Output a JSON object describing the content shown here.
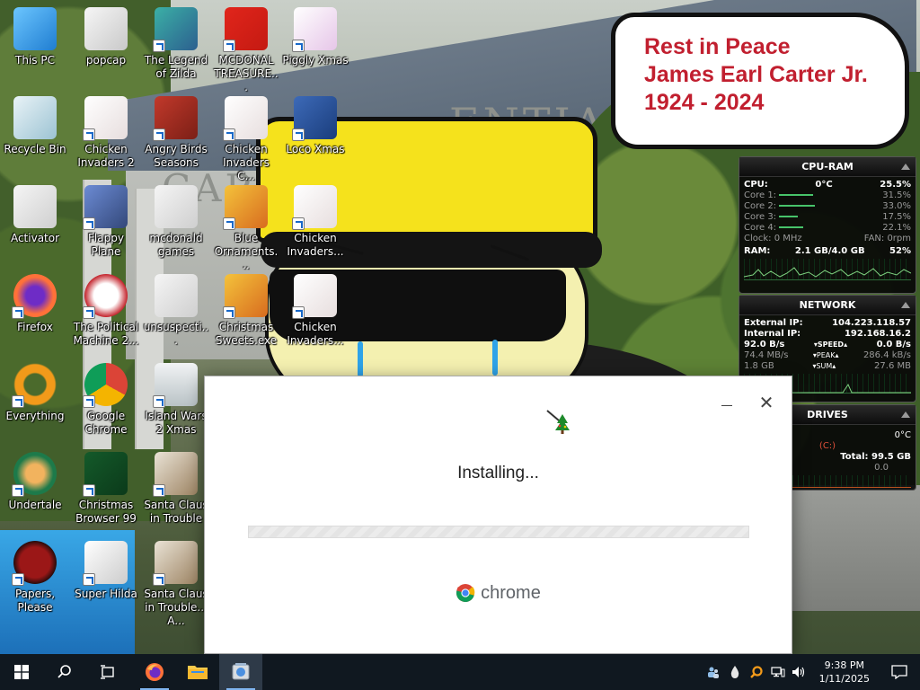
{
  "bubble": {
    "line1": "Rest in Peace",
    "line2": "James Earl Carter Jr.",
    "line3": "1924 - 2024"
  },
  "wallpaper": {
    "engrave_right": "ENTIAL",
    "engrave_left": "CARTE"
  },
  "desktop_icons": [
    {
      "label": "This PC",
      "icon": "computer-icon",
      "shortcut": false
    },
    {
      "label": "popcap",
      "icon": "folder-icon",
      "shortcut": false
    },
    {
      "label": "The Legend of Zilda",
      "icon": "game-icon",
      "shortcut": true
    },
    {
      "label": "MCDONAL TREASURE...",
      "icon": "mcdonalds-icon",
      "shortcut": true
    },
    {
      "label": "Piggly Xmas",
      "icon": "pig-icon",
      "shortcut": true
    },
    {
      "label": "Recycle Bin",
      "icon": "recycle-bin-icon",
      "shortcut": false
    },
    {
      "label": "Chicken Invaders 2",
      "icon": "chicken-icon",
      "shortcut": true
    },
    {
      "label": "Angry Birds Seasons",
      "icon": "angry-birds-icon",
      "shortcut": true
    },
    {
      "label": "Chicken Invaders C...",
      "icon": "chicken-icon",
      "shortcut": true
    },
    {
      "label": "Loco Xmas",
      "icon": "bear-icon",
      "shortcut": true
    },
    {
      "label": "Activator",
      "icon": "file-icon",
      "shortcut": false
    },
    {
      "label": "Flappy Plane",
      "icon": "plane-icon",
      "shortcut": true
    },
    {
      "label": "mcdonald games",
      "icon": "file-icon",
      "shortcut": false
    },
    {
      "label": "Blue Ornaments...",
      "icon": "ornament-icon",
      "shortcut": true
    },
    {
      "label": "Chicken Invaders...",
      "icon": "chicken-icon",
      "shortcut": true
    },
    {
      "label": "Firefox",
      "icon": "firefox-icon",
      "shortcut": true
    },
    {
      "label": "The Political Machine 2...",
      "icon": "political-icon",
      "shortcut": true
    },
    {
      "label": "unsuspecti...",
      "icon": "file-icon",
      "shortcut": false
    },
    {
      "label": "Christmas Sweets.exe",
      "icon": "ornament-icon",
      "shortcut": true
    },
    {
      "label": "Chicken Invaders...",
      "icon": "chicken-icon",
      "shortcut": true
    },
    {
      "label": "Everything",
      "icon": "everything-icon",
      "shortcut": true
    },
    {
      "label": "Google Chrome",
      "icon": "chrome-icon",
      "shortcut": true
    },
    {
      "label": "Island Wars 2 Xmas",
      "icon": "island-icon",
      "shortcut": true
    },
    {
      "label": "Undertale",
      "icon": "undertale-icon",
      "shortcut": true
    },
    {
      "label": "Christmas Browser 99",
      "icon": "xmas-tree-icon",
      "shortcut": true
    },
    {
      "label": "Santa Claus in Trouble",
      "icon": "santa-icon",
      "shortcut": true
    },
    {
      "label": "Papers, Please",
      "icon": "papers-icon",
      "shortcut": true
    },
    {
      "label": "Super Hilda",
      "icon": "pixel-icon",
      "shortcut": true
    },
    {
      "label": "Santa Claus in Trouble... A...",
      "icon": "santa-icon",
      "shortcut": true
    }
  ],
  "cpu_gadget": {
    "title": "CPU-RAM",
    "cpu_label": "CPU:",
    "temp": "0°C",
    "cpu_pct": "25.5%",
    "cores": [
      {
        "label": "Core 1:",
        "value": "31.5%",
        "load": 0.315
      },
      {
        "label": "Core 2:",
        "value": "33.0%",
        "load": 0.33
      },
      {
        "label": "Core 3:",
        "value": "17.5%",
        "load": 0.175
      },
      {
        "label": "Core 4:",
        "value": "22.1%",
        "load": 0.221
      }
    ],
    "clock": "Clock: 0 MHz",
    "fan": "FAN: 0rpm",
    "ram_label": "RAM:",
    "ram_used": "2.1 GB/4.0 GB",
    "ram_pct": "52%"
  },
  "network_gadget": {
    "title": "NETWORK",
    "external_label": "External IP:",
    "external_ip": "104.223.118.57",
    "internal_label": "Internal IP:",
    "internal_ip": "192.168.16.2",
    "speed_down": "92.0 B/s",
    "speed_label": "SPEED",
    "speed_up": "0.0 B/s",
    "peak_down": "74.4 MB/s",
    "peak_label": "PEAK",
    "peak_up": "286.4 kB/s",
    "sum_down": "1.8 GB",
    "sum_label": "SUM",
    "sum_up": "27.6 MB"
  },
  "drives_gadget": {
    "title": "DRIVES",
    "temp": "0°C",
    "drive": "(C:)",
    "used_partial": "GB",
    "total": "Total: 99.5 GB",
    "rate": "0.0"
  },
  "installer": {
    "status": "Installing...",
    "brand": "chrome",
    "progress": 0.0
  },
  "taskbar": {
    "items": [
      "start-button",
      "search-button",
      "task-view-button",
      "firefox-taskbar",
      "file-explorer-taskbar",
      "installer-taskbar"
    ],
    "time": "9:38 PM",
    "date": "1/11/2025"
  }
}
